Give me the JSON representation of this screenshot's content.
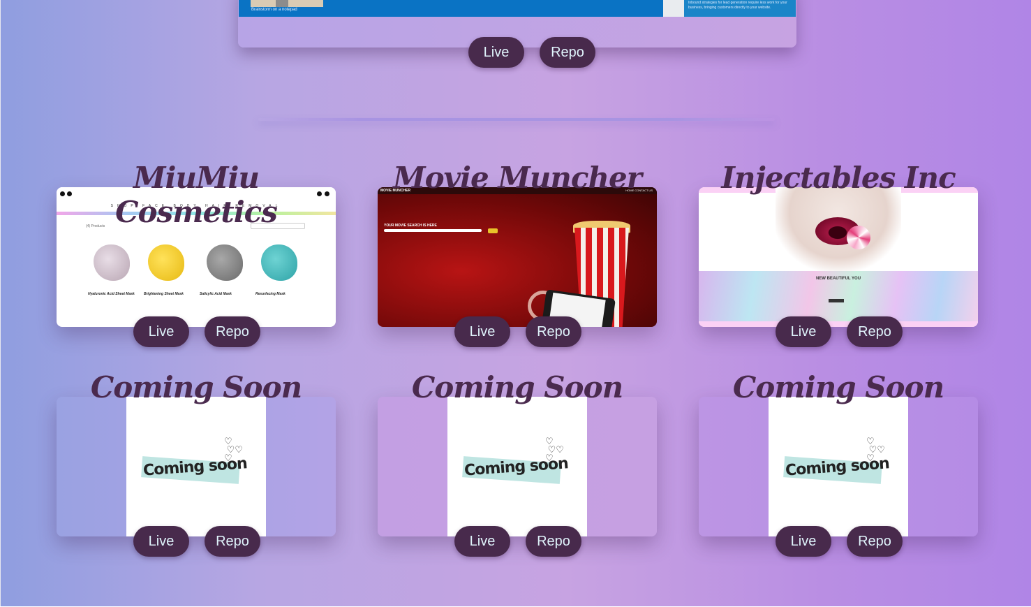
{
  "featured": {
    "caption": "Brainstorm on a notepad",
    "side_text": "Inbound strategies for lead generation require less work for your business, bringing customers directly to your website.",
    "live_label": "Live",
    "repo_label": "Repo"
  },
  "projects": [
    {
      "title": "MiuMiu Cosmetics",
      "live_label": "Live",
      "repo_label": "Repo",
      "nav": "SHOP FACE BODY HAIR REMOVAL",
      "count": "(4) Products",
      "products": [
        "Hyaluronic Acid Sheet Mask",
        "Brightening Sheet Mask",
        "Salicylic Acid Mask",
        "Resurfacing Mask"
      ]
    },
    {
      "title": "Movie Muncher",
      "live_label": "Live",
      "repo_label": "Repo",
      "logo": "MOVIE MUNCHER",
      "links": "HOME CONTACT US",
      "search_label": "YOUR MOVIE SEARCH IS HERE"
    },
    {
      "title": "Injectables Inc",
      "live_label": "Live",
      "repo_label": "Repo",
      "heading": "NEW BEAUTIFUL YOU"
    },
    {
      "title": "Coming Soon",
      "live_label": "Live",
      "repo_label": "Repo",
      "image_text": "Coming soon"
    },
    {
      "title": "Coming Soon",
      "live_label": "Live",
      "repo_label": "Repo",
      "image_text": "Coming soon"
    },
    {
      "title": "Coming Soon",
      "live_label": "Live",
      "repo_label": "Repo",
      "image_text": "Coming soon"
    }
  ],
  "colors": {
    "button_bg": "#482a4c",
    "button_text": "#dff3fb",
    "title": "#4a2a4e",
    "background_left": "#8f9ee0",
    "background_right": "#b085e6"
  }
}
